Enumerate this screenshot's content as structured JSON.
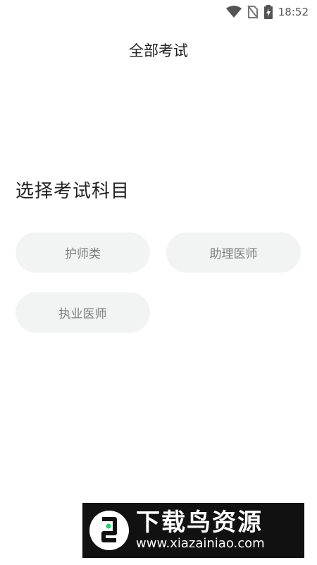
{
  "status_bar": {
    "time": "18:52",
    "icons": [
      "wifi-icon",
      "no-sim-icon",
      "battery-charging-icon"
    ]
  },
  "header": {
    "title": "全部考试"
  },
  "section": {
    "title": "选择考试科目",
    "subjects": [
      {
        "label": "护师类"
      },
      {
        "label": "助理医师"
      },
      {
        "label": "执业医师"
      }
    ]
  },
  "watermark": {
    "brand": "下载鸟资源",
    "url": "www.xiazainiao.com"
  },
  "colors": {
    "chip_background": "#f2f4f4",
    "chip_text": "#7c7c7c",
    "watermark_background": "#111111"
  }
}
